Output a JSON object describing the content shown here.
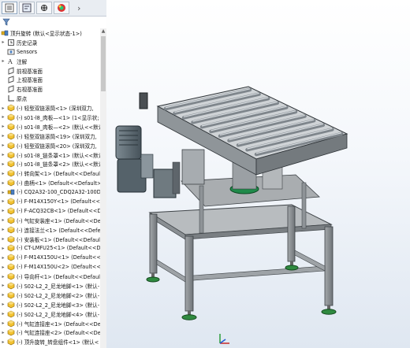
{
  "app": {
    "accent": "#0b5ea8"
  },
  "tabs": [
    {
      "icon": "feature-manager-icon",
      "active": true
    },
    {
      "icon": "property-manager-icon"
    },
    {
      "icon": "configuration-manager-icon"
    },
    {
      "icon": "dimxpert-icon"
    },
    {
      "icon": "display-manager-icon"
    }
  ],
  "tab_chevron": "›",
  "filter_icon": "filter-icon",
  "tree": {
    "root": "顶升旋转 (默认<显示状态-1>)",
    "items": [
      {
        "label": "历史记录",
        "icon": "history-icon",
        "expand": true
      },
      {
        "label": "Sensors",
        "icon": "sensors-icon"
      },
      {
        "label": "注解",
        "icon": "annotations-icon",
        "expand": true
      },
      {
        "label": "前视基准面",
        "icon": "plane-icon"
      },
      {
        "label": "上视基准面",
        "icon": "plane-icon"
      },
      {
        "label": "右视基准面",
        "icon": "plane-icon"
      },
      {
        "label": "原点",
        "icon": "origin-icon"
      },
      {
        "label": "(-) 轻型双链滚筒<1> (深圳双力,",
        "icon": "part-icon",
        "expand": true
      },
      {
        "label": "(-) s01-l8_肉板—<1> (1<显示状;",
        "icon": "part-icon",
        "expand": true
      },
      {
        "label": "(-) s01-l8_肉板—<2> (默认<<默认",
        "icon": "part-icon",
        "expand": true
      },
      {
        "label": "(-) 轻型双链滚筒<19> (深圳双力,",
        "icon": "part-icon",
        "expand": true
      },
      {
        "label": "(-) 轻型双链滚筒<20> (深圳双力,",
        "icon": "part-icon",
        "expand": true
      },
      {
        "label": "(-) s01-l8_链条罩<1> (默认<<默认",
        "icon": "part-icon",
        "expand": true
      },
      {
        "label": "(-) s01-l8_链条罩<2> (默认<<默认",
        "icon": "part-icon",
        "expand": true
      },
      {
        "label": "(-) 转向架<1> (Default<<Default",
        "icon": "part-icon",
        "expand": true
      },
      {
        "label": "(-) 曲柄<1> (Default<<Default>_",
        "icon": "part-icon",
        "expand": true
      },
      {
        "label": "(-) CQ2A32-100_CDQ2A32-100D",
        "icon": "assembly-icon",
        "expand": true
      },
      {
        "label": "(-) F-M14X150Y<1> (Default<<D",
        "icon": "part-icon",
        "expand": true
      },
      {
        "label": "(-) F-ACQ32CB<1> (Default<<D",
        "icon": "part-icon",
        "expand": true
      },
      {
        "label": "(-) 气缸安装座<1> (Default<<De",
        "icon": "part-icon",
        "expand": true
      },
      {
        "label": "(-) 连接法兰<1> (Default<<Defe",
        "icon": "part-icon",
        "expand": true
      },
      {
        "label": "(-) 安装板<1> (Default<<Default",
        "icon": "part-icon",
        "expand": true
      },
      {
        "label": "(-) CT-LMFU25<1> (Default<<D",
        "icon": "part-icon",
        "expand": true
      },
      {
        "label": "(-) F-M14X150U<1> (Default<<",
        "icon": "part-icon",
        "expand": true
      },
      {
        "label": "(-) F-M14X150U<2> (Default<<",
        "icon": "part-icon",
        "expand": true
      },
      {
        "label": "(-) 导向杆<1> (Default<<Defaul",
        "icon": "part-icon",
        "expand": true
      },
      {
        "label": "(-) S02-L2_2_尼龙地脚<1> (默认-",
        "icon": "part-icon",
        "expand": true
      },
      {
        "label": "(-) S02-L2_2_尼龙地脚<2> (默认-",
        "icon": "part-icon",
        "expand": true
      },
      {
        "label": "(-) S02-L2_2_尼龙地脚<3> (默认-",
        "icon": "part-icon",
        "expand": true
      },
      {
        "label": "(-) S02-L2_2_尼龙地脚<4> (默认-",
        "icon": "part-icon",
        "expand": true
      },
      {
        "label": "(-) 气缸连接座<1> (Default<<De",
        "icon": "part-icon",
        "expand": true
      },
      {
        "label": "(-) 气缸连接座<2> (Default<<De",
        "icon": "part-icon",
        "expand": true
      },
      {
        "label": "(-) 顶升旋转_转盘组件<1> (默认<",
        "icon": "part-icon",
        "expand": true
      }
    ]
  },
  "scroll_up": "▲",
  "view": {
    "triad": "xyz-triad-icon"
  }
}
